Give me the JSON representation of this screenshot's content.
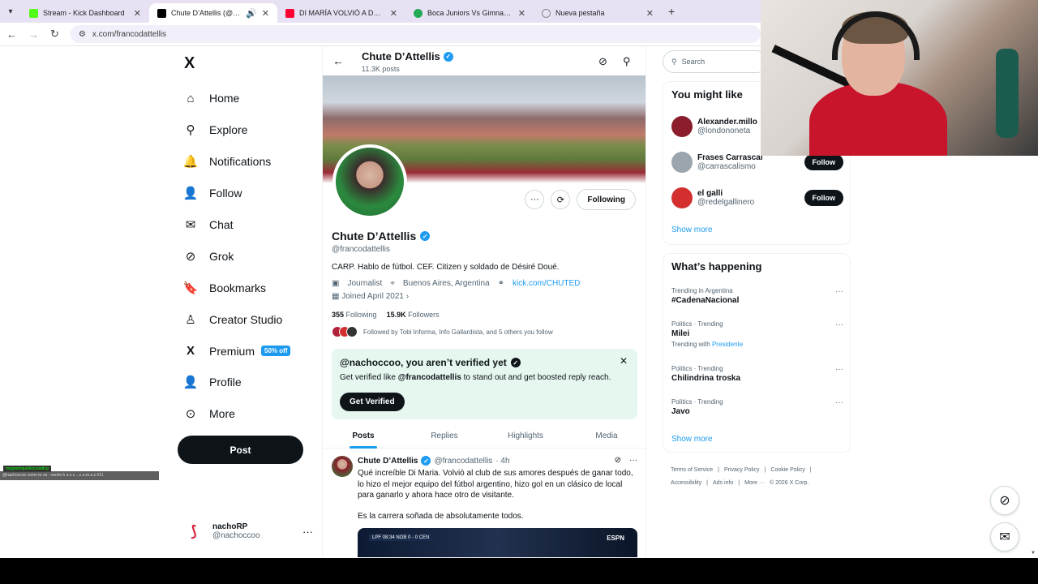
{
  "browser": {
    "tabs": [
      {
        "label": "Stream - Kick Dashboard",
        "favicon_color": "#53fc18",
        "active": false
      },
      {
        "label": "Chute D’Attellis (@francoda",
        "favicon_color": "#000000",
        "active": true
      },
      {
        "label": "DI MARÍA VOLVIÓ A DARLE EL",
        "favicon_color": "#ff0033",
        "active": false
      },
      {
        "label": "Boca Juniors Vs Gimnasia de M",
        "favicon_color": "#22aa55",
        "active": false
      },
      {
        "label": "Nueva pestaña",
        "favicon_color": "#888888",
        "active": false
      }
    ],
    "new_tab_icon": "+",
    "url": "x.com/francodattellis"
  },
  "nav": {
    "logo": "X",
    "items": [
      {
        "label": "Home",
        "icon": "⌂"
      },
      {
        "label": "Explore",
        "icon": "⚲"
      },
      {
        "label": "Notifications",
        "icon": "🔔"
      },
      {
        "label": "Follow",
        "icon": "👤"
      },
      {
        "label": "Chat",
        "icon": "✉"
      },
      {
        "label": "Grok",
        "icon": "⊘"
      },
      {
        "label": "Bookmarks",
        "icon": "🔖"
      },
      {
        "label": "Creator Studio",
        "icon": "♙"
      },
      {
        "label": "Premium",
        "icon": "X"
      },
      {
        "label": "Profile",
        "icon": "👤"
      },
      {
        "label": "More",
        "icon": "⊙"
      }
    ],
    "premium_badge": "50% off",
    "post_button": "Post",
    "me": {
      "name": "nachoRP",
      "handle": "@nachoccoo"
    }
  },
  "stream_overlay": {
    "tag": "magnetoquirkkzyoading",
    "bar": "@nachoccoo como to va - nacho h a z z ...c.o.m.e.z.#11"
  },
  "profile": {
    "top_name": "Chute D’Attellis",
    "posts_count": "11.3K posts",
    "name": "Chute D’Attellis",
    "handle": "@francodattellis",
    "bio": "CARP. Hablo de fútbol. CEF. Citizen y soldado de Désiré Doué.",
    "category": "Journalist",
    "location": "Buenos Aires, Argentina",
    "link": "kick.com/CHUTED",
    "joined": "Joined April 2021",
    "following_count": "355",
    "following_label": "Following",
    "followers_count": "15.9K",
    "followers_label": "Followers",
    "followed_by": "Followed by Tobi Informa, Info Gallardista, and 5 others you follow",
    "following_button": "Following"
  },
  "verify": {
    "title": "@nachoccoo, you aren’t verified yet",
    "text_pre": "Get verified like ",
    "text_handle": "@francodattellis",
    "text_post": " to stand out and get boosted reply reach.",
    "button": "Get Verified"
  },
  "profile_tabs": [
    "Posts",
    "Replies",
    "Highlights",
    "Media"
  ],
  "tweet": {
    "name": "Chute D’Attellis",
    "handle": "@francodattellis",
    "time": "· 4h",
    "text": "Qué increíble Di Maria. Volvió al club de sus amores después de ganar todo, lo hizo el mejor equipo del fútbol argentino, hizo gol en un clásico de local para ganarlo y ahora hace otro de visitante.",
    "text2": "Es la carrera soñada de absolutamente todos.",
    "media_score": "LPF  08:34  NOB  0 - 0  CEN",
    "media_logo": "ESPN"
  },
  "right": {
    "search_placeholder": "Search",
    "you_might_like_title": "You might like",
    "suggestions": [
      {
        "name": "Alexander.millo",
        "handle": "@londononeta",
        "button": "Follow"
      },
      {
        "name": "Frases Carrascal",
        "handle": "@carrascalismo",
        "button": "Follow"
      },
      {
        "name": "el galli",
        "handle": "@redelgallinero",
        "button": "Follow"
      }
    ],
    "show_more": "Show more",
    "happening_title": "What’s happening",
    "trends": [
      {
        "category": "Trending in Argentina",
        "name": "#CadenaNacional",
        "sub": "",
        "sub_link": ""
      },
      {
        "category": "Politics · Trending",
        "name": "Milei",
        "sub": "Trending with ",
        "sub_link": "Presidente"
      },
      {
        "category": "Politics · Trending",
        "name": "Chilindrina troska",
        "sub": "",
        "sub_link": ""
      },
      {
        "category": "Politics · Trending",
        "name": "Javo",
        "sub": "",
        "sub_link": ""
      }
    ],
    "footer": [
      "Terms of Service",
      "|",
      "Privacy Policy",
      "|",
      "Cookie Policy",
      "|",
      "Accessibility",
      "|",
      "Ads info",
      "|",
      "More ···",
      "© 2026 X Corp."
    ]
  }
}
